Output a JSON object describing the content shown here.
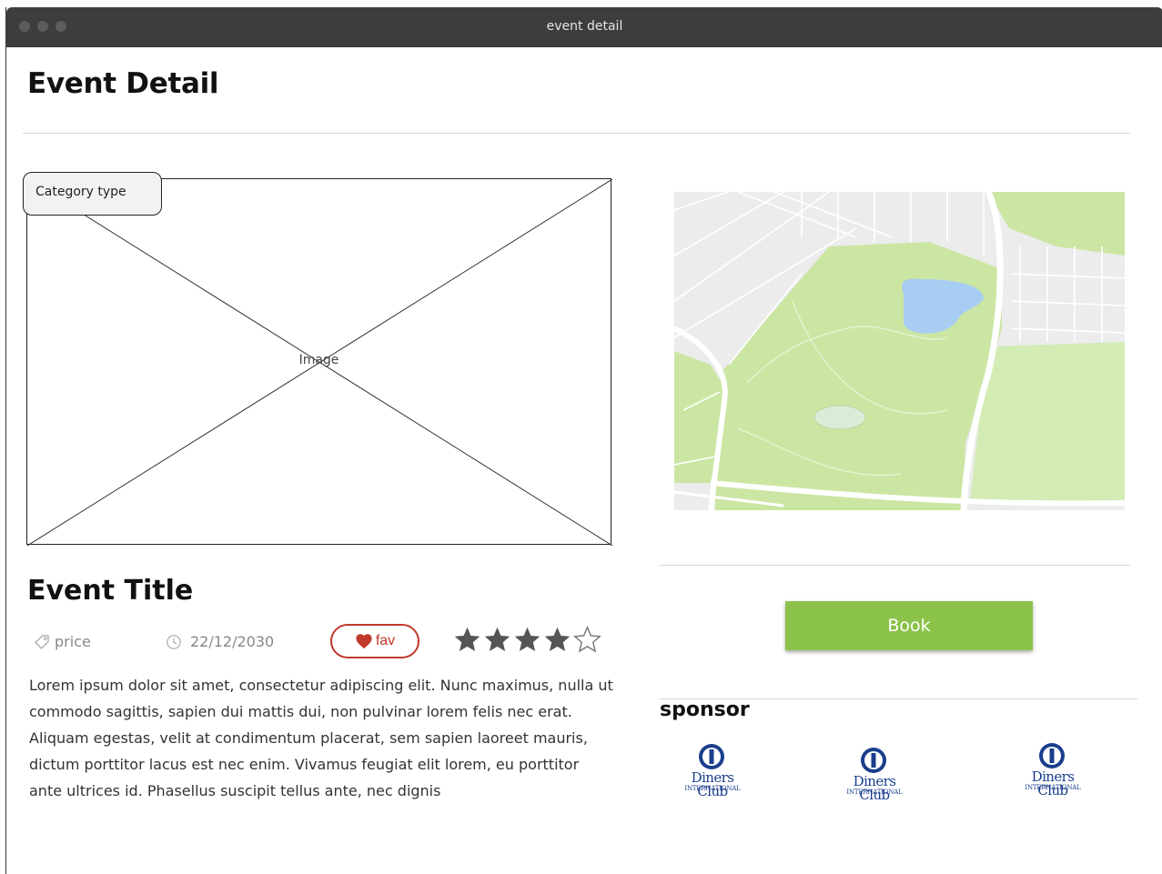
{
  "window": {
    "title": "event detail"
  },
  "page": {
    "title": "Event Detail"
  },
  "event": {
    "category": "Category type",
    "image_label": "Image",
    "title": "Event Title",
    "price_label": "price",
    "date": "22/12/2030",
    "fav_label": "fav",
    "rating": 4,
    "rating_max": 5,
    "description": "Lorem ipsum dolor sit amet, consectetur adipiscing elit. Nunc maximus, nulla ut commodo sagittis, sapien dui mattis dui, non pulvinar lorem felis nec erat. Aliquam egestas, velit at condimentum placerat, sem sapien laoreet mauris, dictum porttitor lacus est nec enim. Vivamus feugiat elit lorem, eu porttitor ante ultrices id. Phasellus suscipit tellus ante, nec dignis"
  },
  "booking": {
    "book_label": "Book"
  },
  "sponsor": {
    "title": "sponsor",
    "logos": [
      {
        "name": "Diners Club",
        "sub": "INTERNATIONAL"
      },
      {
        "name": "Diners Club",
        "sub": "INTERNATIONAL"
      },
      {
        "name": "Diners Club",
        "sub": "INTERNATIONAL"
      }
    ]
  },
  "colors": {
    "accent_green": "#8bc34a",
    "fav_red": "#c0392b",
    "star_gray": "#555555",
    "titlebar": "#3d3d3d",
    "park_green": "#cbe6a3",
    "lake_blue": "#a8cdf2",
    "diners_blue": "#1a3e8c"
  },
  "icons": {
    "price": "tag-icon",
    "date": "clock-icon",
    "fav": "heart-icon",
    "rating": "star-icon"
  }
}
